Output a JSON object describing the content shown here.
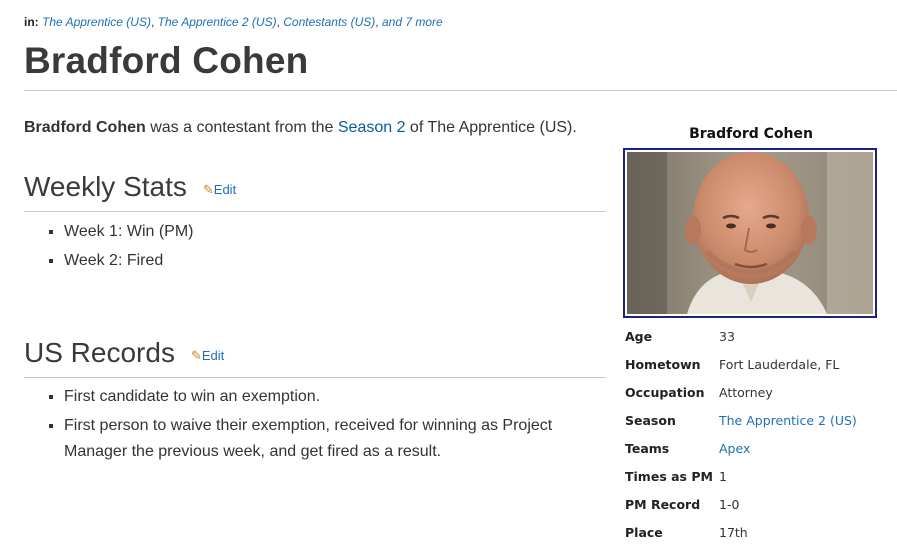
{
  "categories": {
    "prefix": "in:",
    "links": [
      "The Apprentice (US)",
      "The Apprentice 2 (US)",
      "Contestants (US)"
    ],
    "more": "and 7 more"
  },
  "page": {
    "title": "Bradford Cohen",
    "intro_name": "Bradford Cohen",
    "intro_mid": " was a contestant from the ",
    "intro_link": "Season 2",
    "intro_end": " of The Apprentice (US)."
  },
  "sections": [
    {
      "heading": "Weekly Stats",
      "edit_label": "Edit",
      "items": [
        "Week 1: Win (PM)",
        "Week 2: Fired"
      ]
    },
    {
      "heading": "US Records",
      "edit_label": "Edit",
      "items": [
        "First candidate to win an exemption.",
        "First person to waive their exemption, received for winning as Project Manager the previous week, and get fired as a result."
      ]
    }
  ],
  "infobox": {
    "title": "Bradford Cohen",
    "rows": [
      {
        "label": "Age",
        "value": "33",
        "link": false
      },
      {
        "label": "Hometown",
        "value": "Fort Lauderdale, FL",
        "link": false
      },
      {
        "label": "Occupation",
        "value": "Attorney",
        "link": false
      },
      {
        "label": "Season",
        "value": "The Apprentice 2 (US)",
        "link": true
      },
      {
        "label": "Teams",
        "value": "Apex",
        "link": true
      },
      {
        "label": "Times as PM",
        "value": "1",
        "link": false
      },
      {
        "label": "PM Record",
        "value": "1-0",
        "link": false
      },
      {
        "label": "Place",
        "value": "17th",
        "link": false
      }
    ]
  },
  "colors": {
    "link": "#1e6fb5",
    "portrait_border": "#1a237e",
    "rule": "#c8c8c8"
  },
  "icons": [
    "pencil-icon"
  ]
}
